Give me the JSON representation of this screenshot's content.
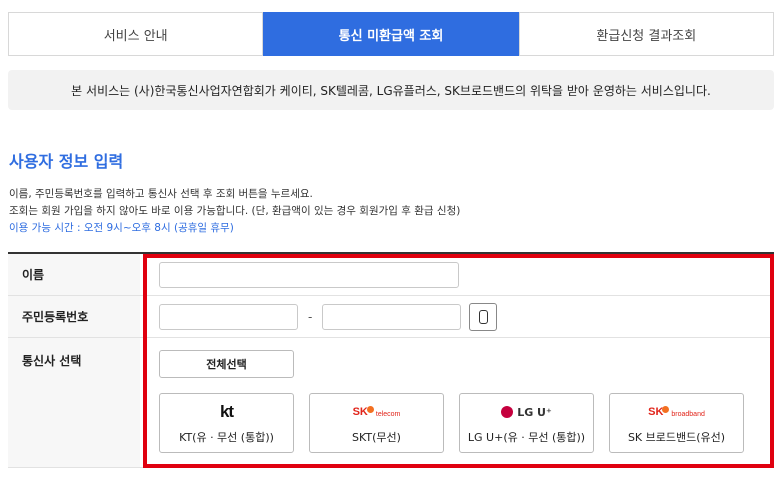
{
  "tabs": [
    {
      "label": "서비스 안내",
      "active": false
    },
    {
      "label": "통신 미환급액 조회",
      "active": true
    },
    {
      "label": "환급신청 결과조회",
      "active": false
    }
  ],
  "notice": "본 서비스는 (사)한국통신사업자연합회가 케이티, SK텔레콤, LG유플러스, SK브로드밴드의 위탁을 받아 운영하는 서비스입니다.",
  "section_title": "사용자 정보 입력",
  "description": {
    "line1": "이름, 주민등록번호를 입력하고 통신사 선택 후 조회 버튼을 누르세요.",
    "line2": "조회는 회원 가입을 하지 않아도 바로 이용 가능합니다. (단, 환급액이 있는 경우 회원가입 후 환급 신청)",
    "hours": "이용 가능 시간 : 오전 9시~오후 8시 (공휴일 휴무)"
  },
  "form": {
    "name_label": "이름",
    "name_value": "",
    "rrn_label": "주민등록번호",
    "rrn_front_value": "",
    "rrn_back_value": "",
    "rrn_separator": "-",
    "carrier_label": "통신사 선택",
    "select_all_label": "전체선택"
  },
  "carriers": [
    {
      "logo_text": "kt",
      "label": "KT(유 · 무선 (통합))",
      "icon": "kt-logo-icon"
    },
    {
      "logo_text": "SK",
      "logo_sub": "telecom",
      "label": "SKT(무선)",
      "icon": "sk-telecom-logo-icon"
    },
    {
      "logo_text": "LG U⁺",
      "label": "LG U+(유 · 무선 (통합))",
      "icon": "lg-uplus-logo-icon"
    },
    {
      "logo_text": "SK",
      "logo_sub": "broadband",
      "label": "SK 브로드밴드(유선)",
      "icon": "sk-broadband-logo-icon"
    }
  ],
  "colors": {
    "accent": "#2f6de0",
    "highlight_border": "#e0000f",
    "notice_bg": "#f2f2f2"
  }
}
